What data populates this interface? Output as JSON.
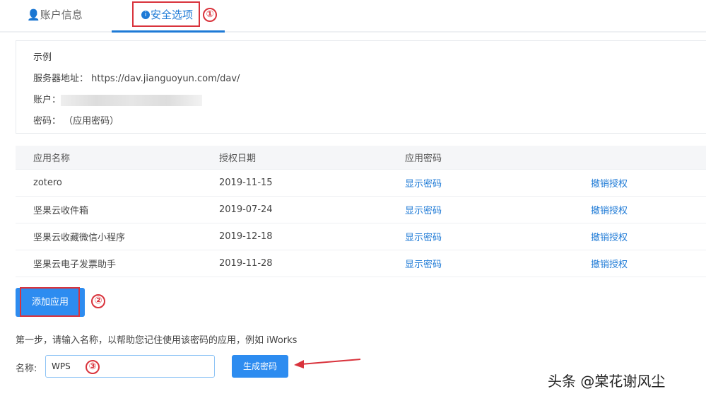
{
  "tabs": [
    {
      "label": "账户信息",
      "icon": "user-icon"
    },
    {
      "label": "安全选项",
      "icon": "info-icon",
      "info_glyph": "i"
    }
  ],
  "annotations": [
    "①",
    "②",
    "③"
  ],
  "example": {
    "title": "示例",
    "server_label": "服务器地址：",
    "server_value": "https://dav.jianguoyun.com/dav/",
    "account_label": "账户：",
    "password_label": "密码：",
    "password_value": "（应用密码）"
  },
  "table": {
    "headers": [
      "应用名称",
      "授权日期",
      "应用密码",
      ""
    ],
    "rows": [
      {
        "name": "zotero",
        "date": "2019-11-15",
        "show": "显示密码",
        "revoke": "撤销授权"
      },
      {
        "name": "坚果云收件箱",
        "date": "2019-07-24",
        "show": "显示密码",
        "revoke": "撤销授权"
      },
      {
        "name": "坚果云收藏微信小程序",
        "date": "2019-12-18",
        "show": "显示密码",
        "revoke": "撤销授权"
      },
      {
        "name": "坚果云电子发票助手",
        "date": "2019-11-28",
        "show": "显示密码",
        "revoke": "撤销授权"
      }
    ]
  },
  "add_button": "添加应用",
  "step_text": "第一步，请输入名称，以帮助您记住使用该密码的应用，例如 iWorks",
  "name_label": "名称:",
  "name_value": "WPS",
  "generate_button": "生成密码",
  "watermark": "头条 @棠花谢风尘"
}
